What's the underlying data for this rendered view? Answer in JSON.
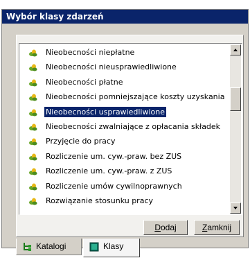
{
  "window": {
    "title": "Wybór klasy zdarzeń"
  },
  "list": {
    "items": [
      {
        "label": "Nieobecności niepłatne",
        "selected": false
      },
      {
        "label": "Nieobecności nieusprawiedliwione",
        "selected": false
      },
      {
        "label": "Nieobecności płatne",
        "selected": false
      },
      {
        "label": "Nieobecności pomniejszające koszty uzyskania",
        "selected": false
      },
      {
        "label": "Nieobecności usprawiedliwione",
        "selected": true
      },
      {
        "label": "Nieobecności zwalniające z opłacania składek",
        "selected": false
      },
      {
        "label": "Przyjęcie do pracy",
        "selected": false
      },
      {
        "label": "Rozliczenie um. cyw.-praw. bez ZUS",
        "selected": false
      },
      {
        "label": "Rozliczenie um. cyw.-praw. z ZUS",
        "selected": false
      },
      {
        "label": "Rozliczenie umów cywilnoprawnych",
        "selected": false
      },
      {
        "label": "Rozwiązanie stosunku pracy",
        "selected": false
      }
    ]
  },
  "buttons": {
    "add": {
      "hotkey": "D",
      "rest": "odaj"
    },
    "close": {
      "hotkey": "Z",
      "rest": "amknij"
    }
  },
  "tabs": [
    {
      "label": "Katalogi",
      "active": false
    },
    {
      "label": "Klasy",
      "active": true
    }
  ],
  "colors": {
    "titlebar": "#0a246a",
    "selection": "#0a246a",
    "face": "#d4d0c8",
    "item_icon_leaf": "#6aa829",
    "item_icon_flower": "#e8b818"
  }
}
